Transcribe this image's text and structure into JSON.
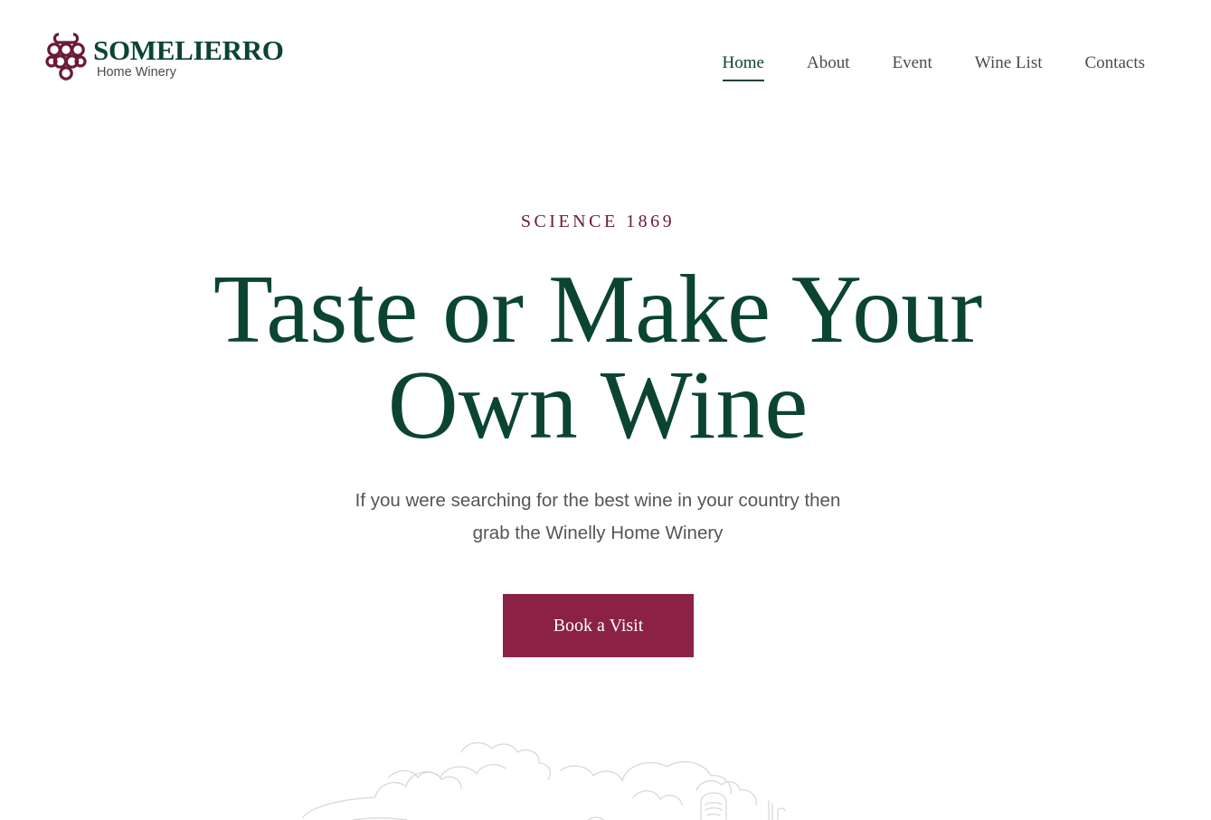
{
  "colors": {
    "brand_green": "#0b4433",
    "brand_wine": "#8b2245",
    "logo_icon": "#6b1a33",
    "nav_text": "#4a4a4a",
    "eyebrow_text": "#6b1a33",
    "subtitle_text": "#555555",
    "button_text": "#ffffff",
    "illustration_stroke": "#d8d8d8"
  },
  "brand": {
    "logo_icon": "grape-cluster-icon",
    "name": "SOMELIERRO",
    "tagline": "Home Winery"
  },
  "nav": {
    "items": [
      {
        "label": "Home",
        "active": true
      },
      {
        "label": "About",
        "active": false
      },
      {
        "label": "Event",
        "active": false
      },
      {
        "label": "Wine List",
        "active": false
      },
      {
        "label": "Contacts",
        "active": false
      }
    ]
  },
  "hero": {
    "eyebrow": "SCIENCE 1869",
    "title_line1": "Taste or Make Your",
    "title_line2": "Own Wine",
    "subtitle_line1": "If you were searching for the best wine in your country then",
    "subtitle_line2": "grab the Winelly Home Winery",
    "cta_label": "Book a Visit",
    "illustration": "vineyard-sketch-illustration"
  }
}
